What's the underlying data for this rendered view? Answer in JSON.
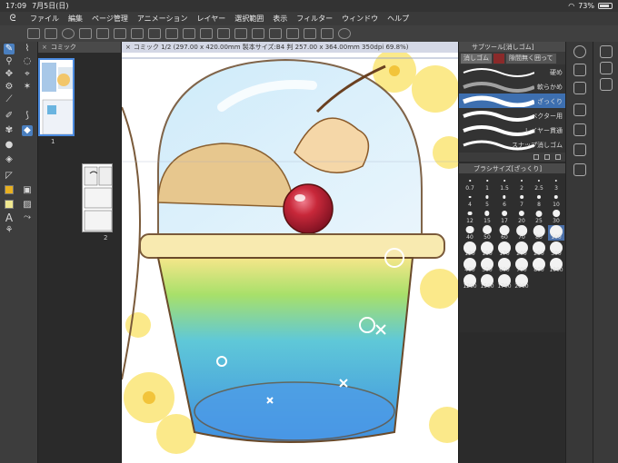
{
  "status": {
    "time": "17:09",
    "date": "7月5日(日)",
    "battery": "73%"
  },
  "menu": {
    "logo_icon": "clip-studio-logo-icon",
    "items": [
      "ファイル",
      "編集",
      "ページ管理",
      "アニメーション",
      "レイヤー",
      "選択範囲",
      "表示",
      "フィルター",
      "ウィンドウ",
      "ヘルプ"
    ]
  },
  "page_panel": {
    "title": "コミック",
    "pages": [
      "1",
      "2"
    ]
  },
  "canvas": {
    "tab_title": "コミック 1/2 (297.00 x 420.00mm 製本サイズ:B4 判 257.00 x 364.00mm 350dpi 69.8%)"
  },
  "subtool": {
    "title": "サブツール[消しゴム]",
    "tabs": [
      "消しゴム",
      "隙間無く囲って"
    ],
    "brushes": [
      "硬め",
      "軟らかめ",
      "ざっくり",
      "ベクター用",
      "レイヤー貫通",
      "スナップ消しゴム"
    ],
    "selected": "ざっくり"
  },
  "brush_size": {
    "title": "ブラシサイズ[ざっくり]",
    "sizes": [
      "0.7",
      "1",
      "1.5",
      "2",
      "2.5",
      "3",
      "4",
      "5",
      "6",
      "7",
      "8",
      "10",
      "12",
      "15",
      "17",
      "20",
      "25",
      "30",
      "40",
      "50",
      "60",
      "70",
      "80",
      "100",
      "120",
      "150",
      "170",
      "200",
      "250",
      "300",
      "400",
      "500",
      "600",
      "700",
      "800",
      "1000",
      "1200",
      "1500",
      "1700",
      "2000"
    ],
    "selected": "100"
  },
  "colors": {
    "accent": "#4a7fbf",
    "canvas_bg": "#ffffff",
    "cherry": "#c8283a"
  }
}
